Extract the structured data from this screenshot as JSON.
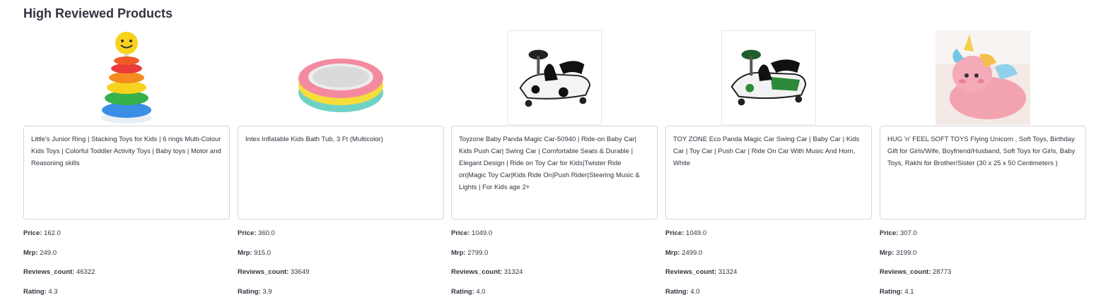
{
  "page": {
    "section_title": "High Reviewed Products"
  },
  "labels": {
    "price": "Price:",
    "mrp": "Mrp:",
    "reviews_count": "Reviews_count:",
    "rating": "Rating:"
  },
  "products": [
    {
      "image_icon": "stacking-ring-toy-icon",
      "title": "Little's Junior Ring | Stacking Toys for Kids | 6 rings Multi-Colour Kids Toys | Colorful Toddler Activity Toys | Baby toys | Motor and Reasoning skills",
      "price": "162.0",
      "mrp": "249.0",
      "reviews_count": "46322",
      "rating": "4.3"
    },
    {
      "image_icon": "inflatable-tub-icon",
      "title": "Intex Inflatable Kids Bath Tub, 3 Ft (Multicolor)",
      "price": "360.0",
      "mrp": "915.0",
      "reviews_count": "33649",
      "rating": "3.9"
    },
    {
      "image_icon": "panda-swing-car-icon",
      "title": "Toyzone Baby Panda Magic Car-50940 | Ride-on Baby Car| Kids Push Car| Swing Car | Comfortable Seats & Durable | Elegant Design | Ride on Toy Car for Kids|Twister Ride on|Magic Toy Car|Kids Ride On|Push Rider|Steering Music & Lights | For Kids age 2+",
      "price": "1049.0",
      "mrp": "2799.0",
      "reviews_count": "31324",
      "rating": "4.0"
    },
    {
      "image_icon": "green-swing-car-icon",
      "title": "TOY ZONE Eco Panda Magic Car Swing Car | Baby Car | Kids Car | Toy Car | Push Car | Ride On Car With Music And Horn, White",
      "price": "1049.0",
      "mrp": "2499.0",
      "reviews_count": "31324",
      "rating": "4.0"
    },
    {
      "image_icon": "unicorn-plush-icon",
      "title": "HUG 'n' FEEL SOFT TOYS Flying Unicorn , Soft Toys, Birthday Gift for Girls/Wife, Boyfriend/Husband, Soft Toys for Girls, Baby Toys, Rakhi for Brother/Sister (30 x 25 x 50 Centimeters )",
      "price": "307.0",
      "mrp": "3199.0",
      "reviews_count": "28773",
      "rating": "4.1"
    }
  ]
}
